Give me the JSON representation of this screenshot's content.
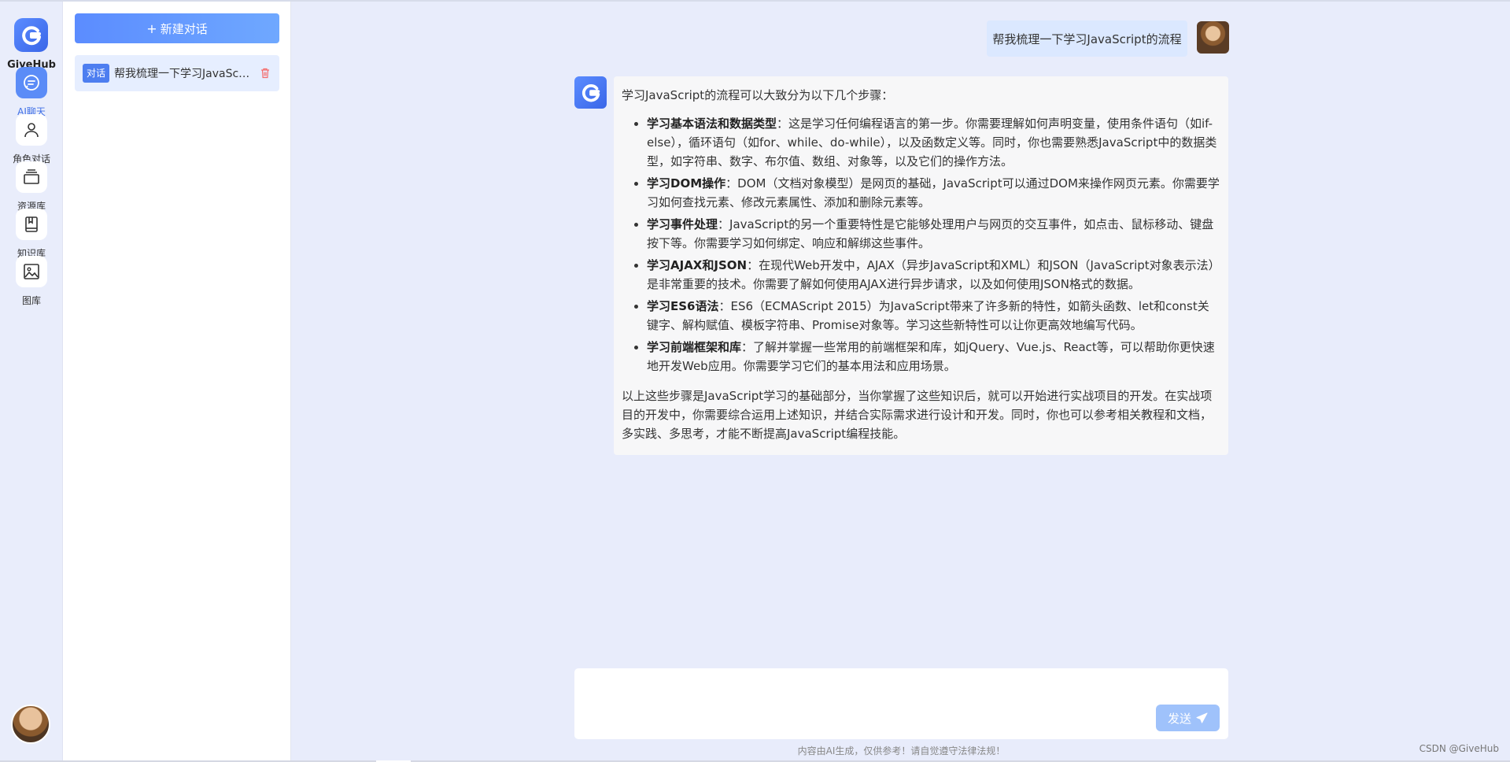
{
  "app": {
    "brand": "GiveHub"
  },
  "rail": {
    "items": [
      {
        "label": "AI聊天",
        "icon": "chat-icon"
      },
      {
        "label": "角色对话",
        "icon": "person-icon"
      },
      {
        "label": "资源库",
        "icon": "layers-icon"
      },
      {
        "label": "知识库",
        "icon": "book-icon"
      },
      {
        "label": "图库",
        "icon": "image-icon"
      }
    ]
  },
  "history": {
    "new_chat_label": "新建对话",
    "conversations": [
      {
        "tag": "对话",
        "title": "帮我梳理一下学习JavaScript的流程"
      }
    ]
  },
  "chat": {
    "user_message": "帮我梳理一下学习JavaScript的流程",
    "bot_intro": "学习JavaScript的流程可以大致分为以下几个步骤：",
    "bot_steps": [
      {
        "title": "学习基本语法和数据类型",
        "text": "：这是学习任何编程语言的第一步。你需要理解如何声明变量，使用条件语句（如if-else），循环语句（如for、while、do-while），以及函数定义等。同时，你也需要熟悉JavaScript中的数据类型，如字符串、数字、布尔值、数组、对象等，以及它们的操作方法。"
      },
      {
        "title": "学习DOM操作",
        "text": "：DOM（文档对象模型）是网页的基础，JavaScript可以通过DOM来操作网页元素。你需要学习如何查找元素、修改元素属性、添加和删除元素等。"
      },
      {
        "title": "学习事件处理",
        "text": "：JavaScript的另一个重要特性是它能够处理用户与网页的交互事件，如点击、鼠标移动、键盘按下等。你需要学习如何绑定、响应和解绑这些事件。"
      },
      {
        "title": "学习AJAX和JSON",
        "text": "：在现代Web开发中，AJAX（异步JavaScript和XML）和JSON（JavaScript对象表示法）是非常重要的技术。你需要了解如何使用AJAX进行异步请求，以及如何使用JSON格式的数据。"
      },
      {
        "title": "学习ES6语法",
        "text": "：ES6（ECMAScript 2015）为JavaScript带来了许多新的特性，如箭头函数、let和const关键字、解构赋值、模板字符串、Promise对象等。学习这些新特性可以让你更高效地编写代码。"
      },
      {
        "title": "学习前端框架和库",
        "text": "：了解并掌握一些常用的前端框架和库，如jQuery、Vue.js、React等，可以帮助你更快速地开发Web应用。你需要学习它们的基本用法和应用场景。"
      }
    ],
    "bot_conclusion": "以上这些步骤是JavaScript学习的基础部分，当你掌握了这些知识后，就可以开始进行实战项目的开发。在实战项目的开发中，你需要综合运用上述知识，并结合实际需求进行设计和开发。同时，你也可以参考相关教程和文档，多实践、多思考，才能不断提高JavaScript编程技能。"
  },
  "composer": {
    "value": "",
    "send_label": "发送"
  },
  "footer": {
    "disclaimer": "内容由AI生成，仅供参考！请自觉遵守法律法规！",
    "watermark": "CSDN @GiveHub"
  },
  "colors": {
    "accent": "#5b8cf7",
    "send_disabled": "#9fc2fb",
    "danger": "#f56c6c"
  }
}
